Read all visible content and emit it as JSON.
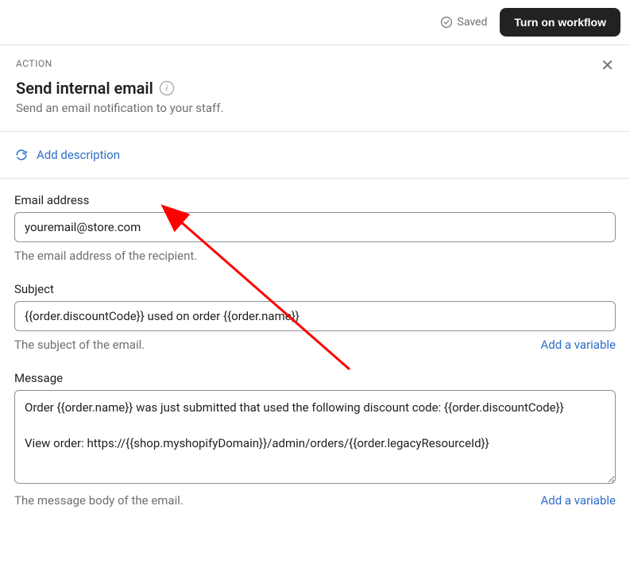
{
  "topBar": {
    "savedLabel": "Saved",
    "turnOnLabel": "Turn on workflow"
  },
  "panel": {
    "actionLabel": "ACTION",
    "title": "Send internal email",
    "subtitle": "Send an email notification to your staff."
  },
  "addDescription": {
    "label": "Add description"
  },
  "fields": {
    "email": {
      "label": "Email address",
      "value": "youremail@store.com",
      "hint": "The email address of the recipient."
    },
    "subject": {
      "label": "Subject",
      "value": "{{order.discountCode}} used on order {{order.name}}",
      "hint": "The subject of the email.",
      "addVariable": "Add a variable"
    },
    "message": {
      "label": "Message",
      "value": "Order {{order.name}} was just submitted that used the following discount code: {{order.discountCode}}\n\nView order: https://{{shop.myshopifyDomain}}/admin/orders/{{order.legacyResourceId}}",
      "hint": "The message body of the email.",
      "addVariable": "Add a variable"
    }
  }
}
